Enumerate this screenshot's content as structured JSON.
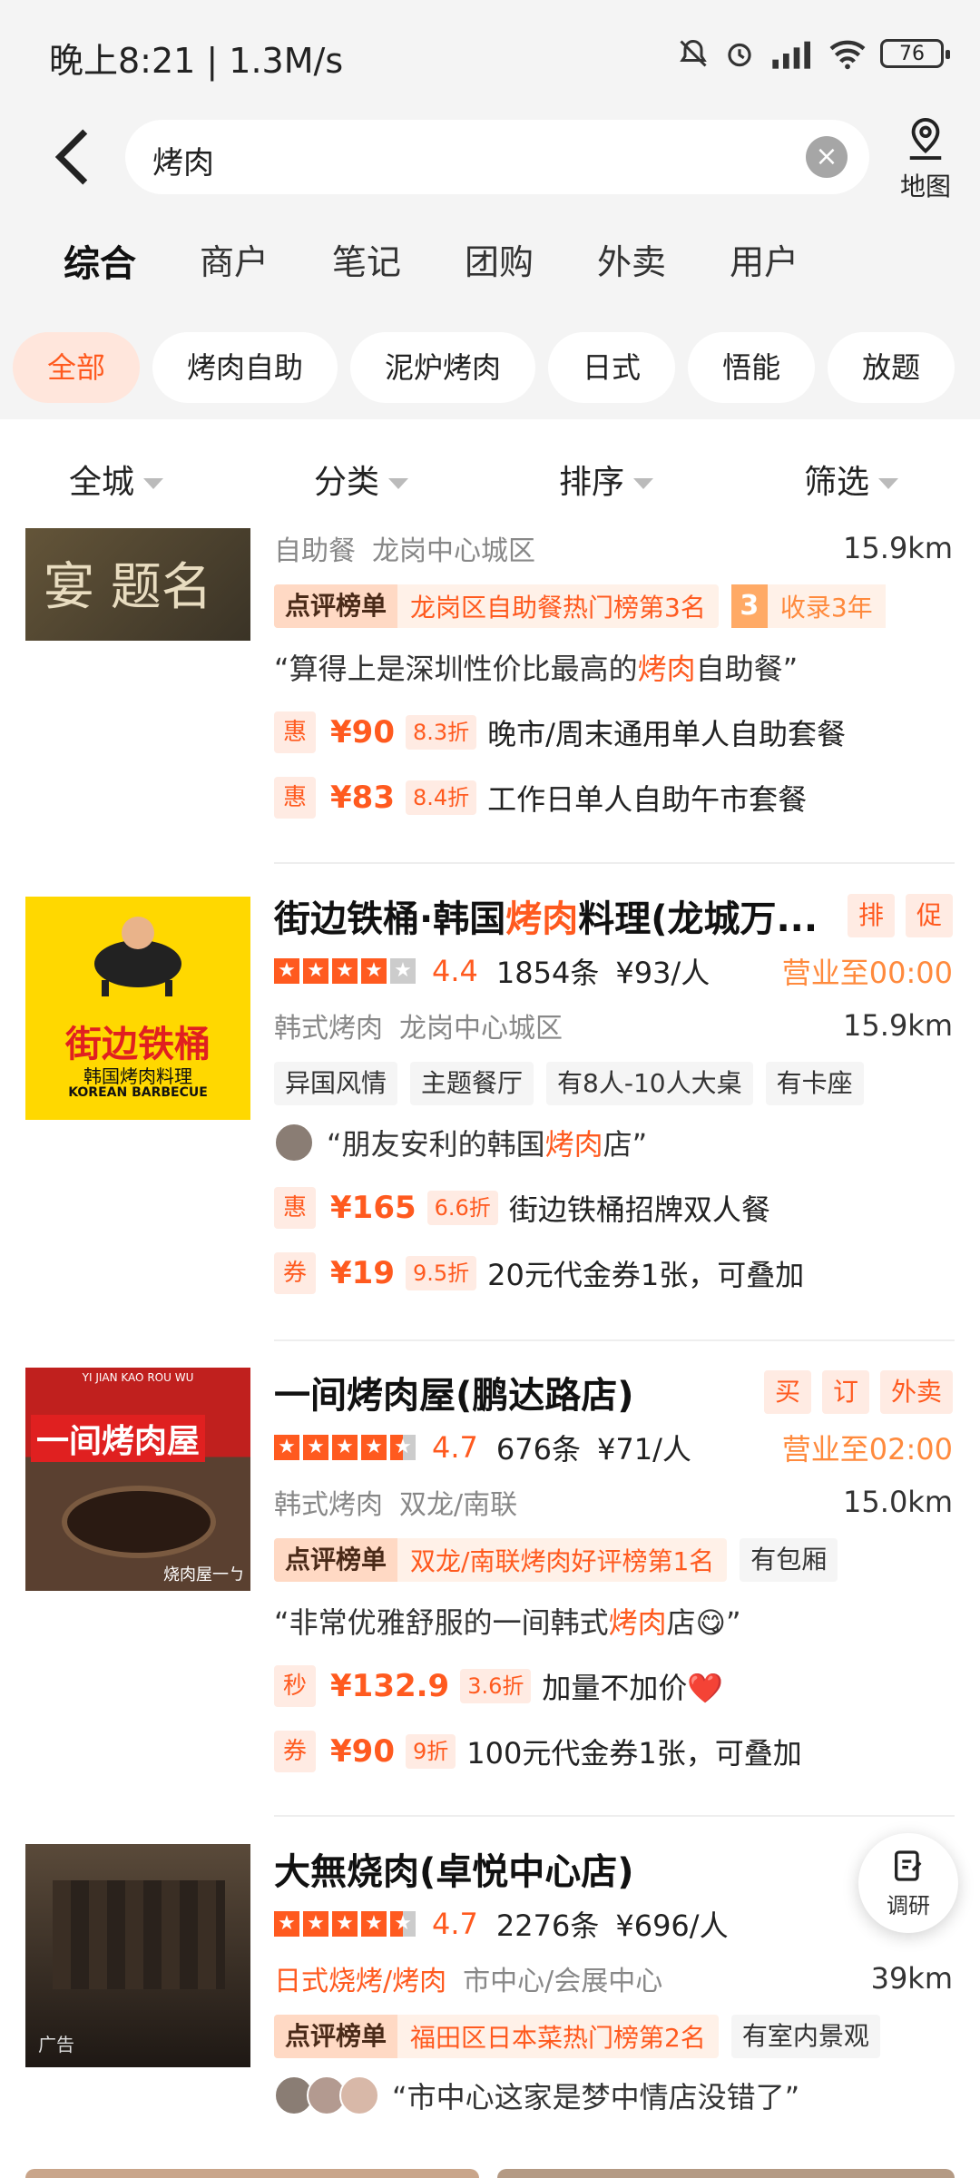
{
  "status_bar": {
    "time": "晚上8:21 | 1.3M/s",
    "battery": "76"
  },
  "search": {
    "query": "烤肉",
    "map_label": "地图"
  },
  "tabs": [
    "综合",
    "商户",
    "笔记",
    "团购",
    "外卖",
    "用户"
  ],
  "chips": [
    "全部",
    "烤肉自助",
    "泥炉烤肉",
    "日式",
    "悟能",
    "放题"
  ],
  "filters": [
    "全城",
    "分类",
    "排序",
    "筛选"
  ],
  "colors": {
    "accent": "#ff5a1f",
    "open_hours": "#ff8a3d"
  },
  "listings": [
    {
      "category": "自助餐",
      "area": "龙岗中心城区",
      "distance": "15.9km",
      "rank_badge": "点评榜单",
      "rank_text": "龙岗区自助餐热门榜第3名",
      "years_number": "3",
      "years_text": "收录3年",
      "quote_pre": "“算得上是深圳性价比最高的",
      "quote_hl": "烤肉",
      "quote_post": "自助餐”",
      "deals": [
        {
          "badge": "惠",
          "price": "¥90",
          "discount": "8.3折",
          "text": "晚市/周末通用单人自助套餐"
        },
        {
          "badge": "惠",
          "price": "¥83",
          "discount": "8.4折",
          "text": "工作日单人自助午市套餐"
        }
      ],
      "thumb_text": "宴 题名"
    },
    {
      "title_pre": "街边铁桶·韩国",
      "title_hl": "烤肉",
      "title_post": "料理(龙城万...",
      "right_tags": [
        "排",
        "促"
      ],
      "rating": "4.4",
      "reviews": "1854条",
      "avg_price": "¥93/人",
      "hours": "营业至00:00",
      "category": "韩式烤肉",
      "area": "龙岗中心城区",
      "distance": "15.9km",
      "tags": [
        "异国风情",
        "主题餐厅",
        "有8人-10人大桌",
        "有卡座"
      ],
      "quote_pre": "“朋友安利的韩国",
      "quote_hl": "烤肉",
      "quote_post": "店”",
      "deals": [
        {
          "badge": "惠",
          "price": "¥165",
          "discount": "6.6折",
          "text": "街边铁桶招牌双人餐"
        },
        {
          "badge": "券",
          "price": "¥19",
          "discount": "9.5折",
          "text": "20元代金券1张，可叠加"
        }
      ],
      "thumb_text_main": "街边铁桶",
      "thumb_text_sub": "韩国烤肉料理",
      "thumb_text_en": "KOREAN BARBECUE"
    },
    {
      "title": "一间烤肉屋(鹏达路店)",
      "right_tags": [
        "买",
        "订",
        "外卖"
      ],
      "rating": "4.7",
      "reviews": "676条",
      "avg_price": "¥71/人",
      "hours": "营业至02:00",
      "category": "韩式烤肉",
      "area": "双龙/南联",
      "distance": "15.0km",
      "rank_badge": "点评榜单",
      "rank_text": "双龙/南联烤肉好评榜第1名",
      "extra_tag": "有包厢",
      "quote_pre": "“非常优雅舒服的一间韩式",
      "quote_hl": "烤肉",
      "quote_post": "店😋”",
      "deals": [
        {
          "badge": "秒",
          "price": "¥132.9",
          "discount": "3.6折",
          "text": "加量不加价❤️"
        },
        {
          "badge": "券",
          "price": "¥90",
          "discount": "9折",
          "text": "100元代金券1张，可叠加"
        }
      ],
      "thumb_banner": "YI JIAN KAO ROU WU",
      "thumb_title": "一间烤肉屋",
      "thumb_caption": "烧肉屋一ㄅ"
    },
    {
      "title": "大無烧肉(卓悦中心店)",
      "rating": "4.7",
      "reviews": "2276条",
      "avg_price": "¥696/人",
      "category": "日式烧烤/烤肉",
      "area": "市中心/会展中心",
      "distance": "39km",
      "rank_badge": "点评榜单",
      "rank_text": "福田区日本菜热门榜第2名",
      "extra_tag": "有室内景观",
      "quote": "“市中心这家是梦中情店没错了”",
      "ad_label": "广告"
    }
  ],
  "float_button": {
    "label": "调研"
  }
}
